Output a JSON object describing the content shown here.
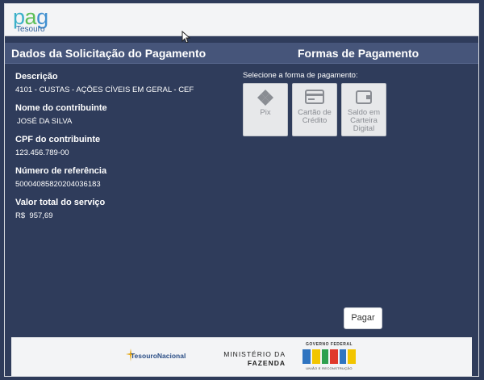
{
  "header": {
    "logo_text": "pag",
    "logo_subtext": "Tesouro"
  },
  "left_panel": {
    "title": "Dados da Solicitação do Pagamento",
    "fields": [
      {
        "label": "Descrição",
        "value": "4101 - CUSTAS - AÇÕES CÍVEIS EM GERAL - CEF"
      },
      {
        "label": "Nome do contribuinte",
        "value": "JOSÉ DA SILVA"
      },
      {
        "label": "CPF do contribuinte",
        "value": "123.456.789-00"
      },
      {
        "label": "Número de referência",
        "value": "50004085820204036183"
      },
      {
        "label": "Valor total do serviço",
        "value": "R$  957,69"
      }
    ]
  },
  "right_panel": {
    "title": "Formas de Pagamento",
    "prompt": "Selecione a forma de pagamento:",
    "options": [
      {
        "label": "Pix",
        "icon": "pix-icon"
      },
      {
        "label_line1": "Cartão de",
        "label_line2": "Crédito",
        "icon": "credit-card-icon"
      },
      {
        "label_line1": "Saldo em",
        "label_line2": "Carteira",
        "label_line3": "Digital",
        "icon": "wallet-icon"
      }
    ]
  },
  "actions": {
    "pay_label": "Pagar"
  },
  "footer": {
    "tesouro_nacional": "TesouroNacional",
    "ministerio_line1": "MINISTÉRIO DA",
    "ministerio_line2": "FAZENDA",
    "gov_federal": "GOVERNO FEDERAL",
    "brasil": "BRASIL",
    "uniao": "UNIÃO E RECONSTRUÇÃO"
  },
  "colors": {
    "background": "#2e3b5a",
    "section_header": "#46557a",
    "topbar": "#f3f4f6"
  }
}
